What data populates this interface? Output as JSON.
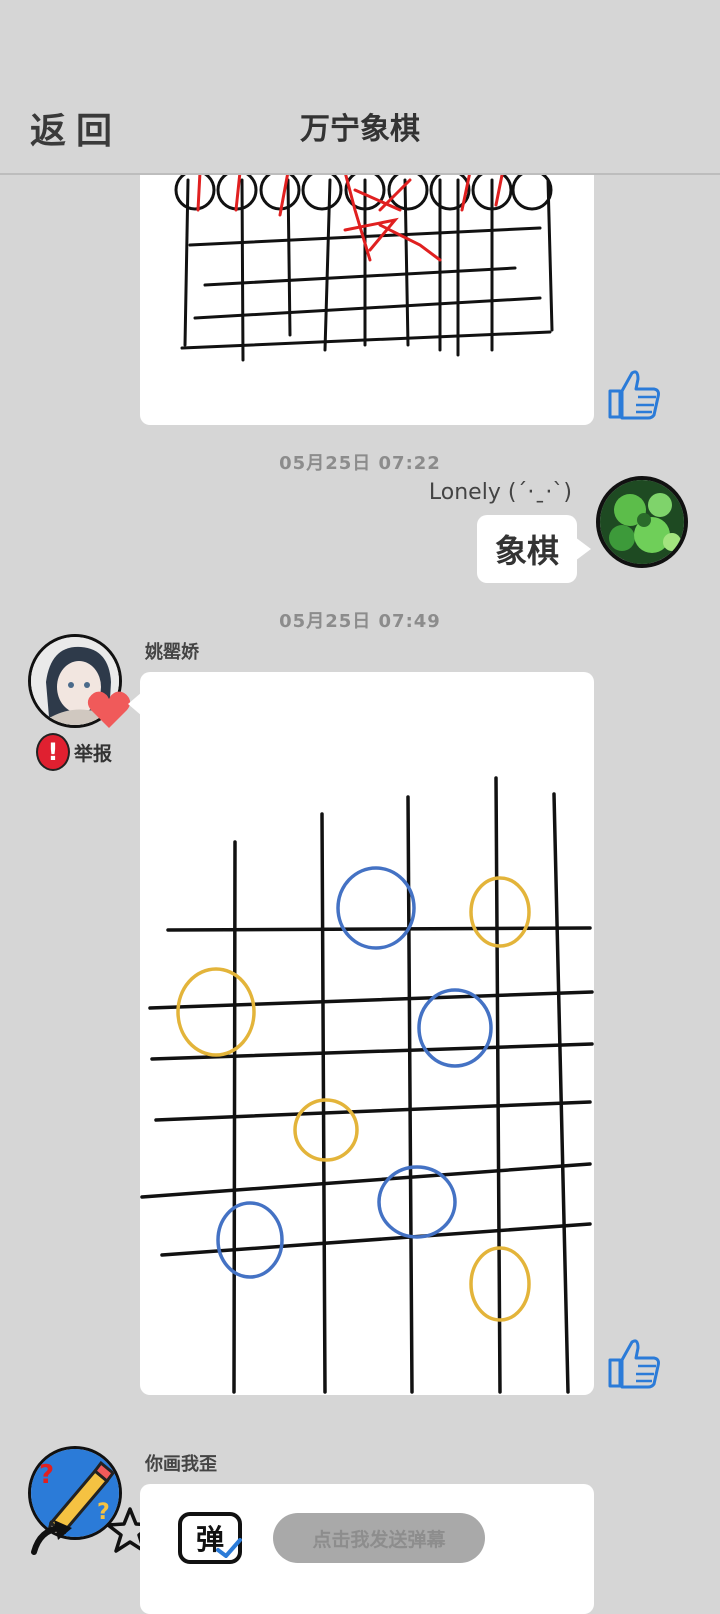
{
  "header": {
    "back_label": "返回",
    "title": "万宁象棋"
  },
  "messages": [
    {
      "timestamp": "05月25日  07:22",
      "user": "Lonely (ˊ·ˍ·ˋ)",
      "text": "象棋"
    },
    {
      "timestamp": "05月25日  07:49",
      "user": "姚罂娇",
      "report_label": "举报"
    },
    {
      "user": "你画我歪",
      "danmaku_label": "点击我发送弹幕",
      "danmaku_icon_text": "弹"
    }
  ],
  "colors": {
    "background": "#d6d6d6",
    "like": "#2b7bd8",
    "ink_red": "#e02020",
    "circle_blue": "#4472c4",
    "circle_yellow": "#e3b43a",
    "report_red": "#e02030",
    "heart": "#f05a5a"
  },
  "icons": [
    "thumbs-up-icon",
    "heart-icon",
    "exclamation-icon",
    "star-icon",
    "pencil-icon",
    "danmaku-icon"
  ]
}
